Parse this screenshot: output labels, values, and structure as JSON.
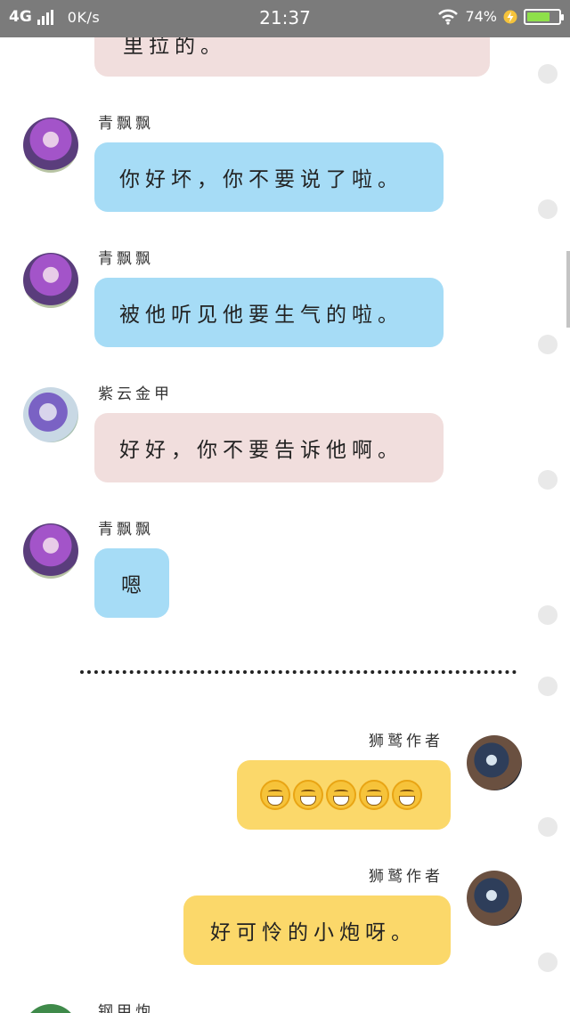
{
  "status_bar": {
    "network": "4G",
    "speed": "0K/s",
    "time": "21:37",
    "battery_percent": "74%",
    "battery_level": 0.74,
    "colors": {
      "bar_bg": "#7b7b7b",
      "battery_fill": "#8ee04a",
      "charging": "#f5c33b"
    }
  },
  "messages": [
    {
      "sender": "",
      "text": "里拉的。",
      "side": "left",
      "style": "pink"
    },
    {
      "sender": "青飘飘",
      "text": "你好坏，你不要说了啦。",
      "side": "left",
      "style": "blue",
      "avatar": "purple-hair-avatar"
    },
    {
      "sender": "青飘飘",
      "text": "被他听见他要生气的啦。",
      "side": "left",
      "style": "blue",
      "avatar": "purple-hair-avatar"
    },
    {
      "sender": "紫云金甲",
      "text": "好好，你不要告诉他啊。",
      "side": "left",
      "style": "pink",
      "avatar": "anime-girl-avatar"
    },
    {
      "sender": "青飘飘",
      "text": "嗯",
      "side": "left",
      "style": "blue",
      "avatar": "purple-hair-avatar"
    },
    {
      "sender": "狮鹫作者",
      "text": "",
      "emoji": "grinning-face-emoji",
      "emoji_count": 5,
      "side": "right",
      "style": "yellow",
      "avatar": "dark-knight-avatar"
    },
    {
      "sender": "狮鹫作者",
      "text": "好可怜的小炮呀。",
      "side": "right",
      "style": "yellow",
      "avatar": "dark-knight-avatar"
    },
    {
      "sender": "钢甲炮",
      "text": "",
      "side": "left",
      "avatar": "green-avatar"
    }
  ],
  "colors": {
    "bubble_blue": "#a6dcf6",
    "bubble_pink": "#f1dedd",
    "bubble_yellow": "#fbd86a"
  }
}
